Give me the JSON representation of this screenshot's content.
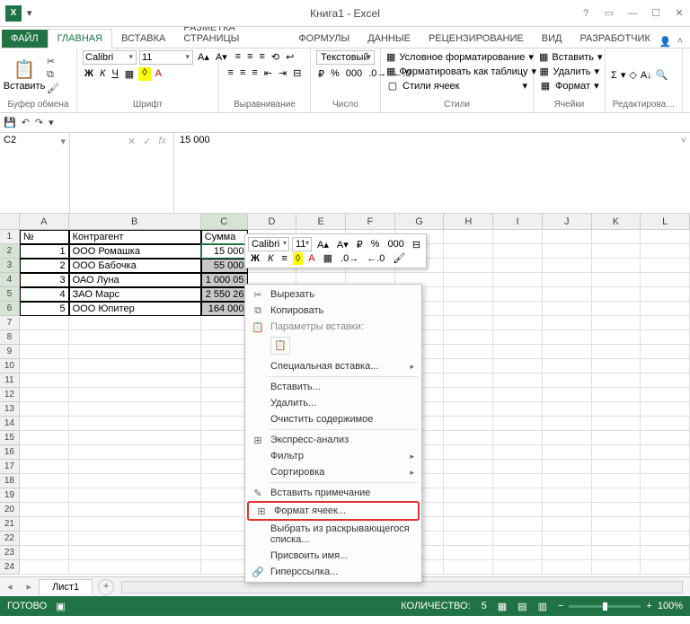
{
  "title": "Книга1 - Excel",
  "ribbon_tabs": {
    "file": "ФАЙЛ",
    "home": "ГЛАВНАЯ",
    "insert": "ВСТАВКА",
    "pagelayout": "РАЗМЕТКА СТРАНИЦЫ",
    "formulas": "ФОРМУЛЫ",
    "data": "ДАННЫЕ",
    "review": "РЕЦЕНЗИРОВАНИЕ",
    "view": "ВИД",
    "developer": "РАЗРАБОТЧИК"
  },
  "groups": {
    "clipboard": "Буфер обмена",
    "font": "Шрифт",
    "alignment": "Выравнивание",
    "number": "Число",
    "styles": "Стили",
    "cells": "Ячейки",
    "editing": "Редактирова…",
    "paste": "Вставить",
    "font_name": "Calibri",
    "font_size": "11",
    "number_format": "Текстовый",
    "cond_fmt": "Условное форматирование",
    "fmt_table": "Форматировать как таблицу",
    "cell_styles": "Стили ячеек",
    "insert_btn": "Вставить",
    "delete_btn": "Удалить",
    "format_btn": "Формат"
  },
  "namebox": "C2",
  "formula": "15 000",
  "columns": [
    "A",
    "B",
    "C",
    "D",
    "E",
    "F",
    "G",
    "H",
    "I",
    "J",
    "K",
    "L"
  ],
  "headers": {
    "a": "№",
    "b": "Контрагент",
    "c": "Сумма"
  },
  "data_rows": [
    {
      "n": "1",
      "b": "ООО Ромашка",
      "c": "15 000"
    },
    {
      "n": "2",
      "b": "ООО Бабочка",
      "c": "55 000"
    },
    {
      "n": "3",
      "b": "ОАО Луна",
      "c": "1 000 05"
    },
    {
      "n": "4",
      "b": "ЗАО Марс",
      "c": "2 550 26"
    },
    {
      "n": "5",
      "b": "ООО Юпитер",
      "c": "164 000"
    }
  ],
  "mini": {
    "font": "Calibri",
    "size": "11"
  },
  "context_menu": {
    "cut": "Вырезать",
    "copy": "Копировать",
    "paste_opts": "Параметры вставки:",
    "paste_special": "Специальная вставка...",
    "insert": "Вставить...",
    "delete": "Удалить...",
    "clear": "Очистить содержимое",
    "quick": "Экспресс-анализ",
    "filter": "Фильтр",
    "sort": "Сортировка",
    "comment": "Вставить примечание",
    "format_cells": "Формат ячеек...",
    "dropdown": "Выбрать из раскрывающегося списка...",
    "define_name": "Присвоить имя...",
    "hyperlink": "Гиперссылка..."
  },
  "sheet": "Лист1",
  "status": {
    "ready": "ГОТОВО",
    "count_label": "КОЛИЧЕСТВО:",
    "count": "5",
    "zoom": "100%"
  }
}
